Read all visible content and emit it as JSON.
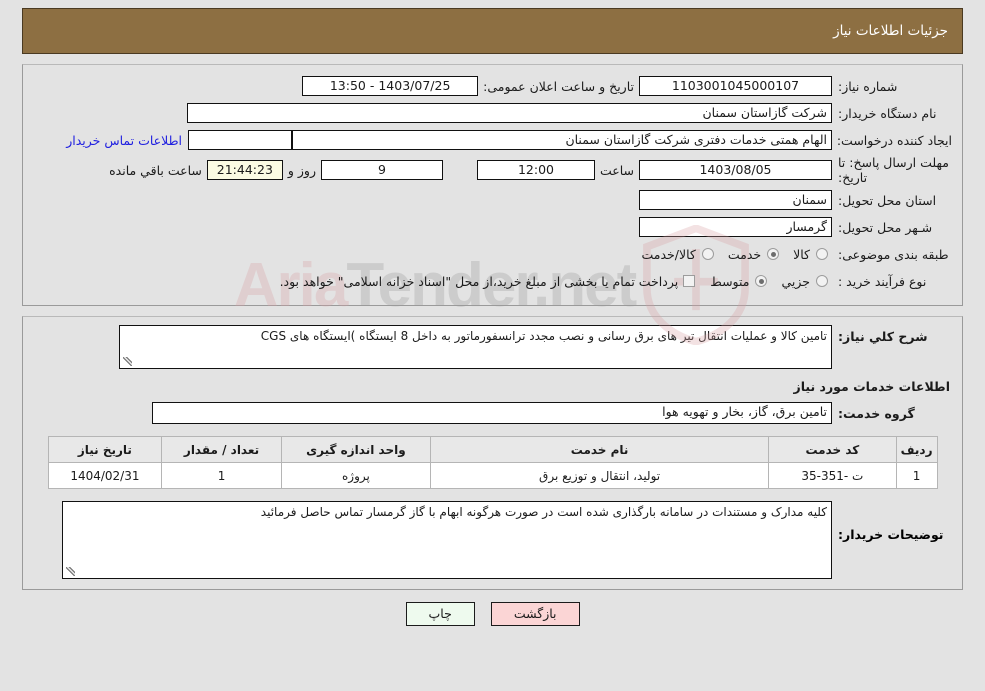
{
  "header": {
    "title": "جزئیات اطلاعات نیاز"
  },
  "form": {
    "need_number_label": "شماره نیاز:",
    "need_number_value": "1103001045000107",
    "public_announce_label": "تاریخ و ساعت اعلان عمومی:",
    "public_announce_value": "1403/07/25 - 13:50",
    "buyer_org_label": "نام دستگاه خریدار:",
    "buyer_org_value": "شرکت گازاستان سمنان",
    "creator_label": "ایجاد کننده درخواست:",
    "creator_value": "الهام همتی خدمات دفتری شرکت گازاستان سمنان",
    "contact_link": "اطلاعات تماس خریدار",
    "deadline_label_line1": "مهلت ارسال پاسخ: تا",
    "deadline_label_line2": "تاریخ:",
    "deadline_date": "1403/08/05",
    "hour_label": "ساعت",
    "deadline_time": "12:00",
    "days_value": "9",
    "days_label": "روز و",
    "countdown_value": "21:44:23",
    "countdown_label": "ساعت باقي مانده",
    "province_label": "استان محل تحویل:",
    "province_value": "سمنان",
    "city_label": "شـهر محل تحویل:",
    "city_value": "گرمسار",
    "category_label": "طبقه بندی موضوعی:",
    "category_options": [
      {
        "label": "کالا",
        "selected": false
      },
      {
        "label": "خدمت",
        "selected": true
      },
      {
        "label": "کالا/خدمت",
        "selected": false
      }
    ],
    "process_label": "نوع فرآیند خرید :",
    "process_options": [
      {
        "label": "جزیي",
        "selected": false
      },
      {
        "label": "متوسط",
        "selected": true
      }
    ],
    "treasury_checkbox_checked": false,
    "treasury_note": "پرداخت تمام یا بخشی از مبلغ خرید،از محل \"اسناد خزانه اسلامی\" خواهد بود."
  },
  "description": {
    "label": "شرح کلي نیاز:",
    "value": "تامین کالا و عملیات انتقال تیر های برق رسانی و نصب مجدد ترانسفورماتور به داخل 8 ایستگاه )ایستگاه های CGS"
  },
  "services": {
    "section_title": "اطلاعات خدمات مورد نیاز",
    "group_label": "گروه خدمت:",
    "group_value": "تامین برق، گاز، بخار و تهویه هوا",
    "table": {
      "columns": [
        "ردیف",
        "کد خدمت",
        "نام خدمت",
        "واحد اندازه گیری",
        "تعداد / مقدار",
        "تاریخ نیاز"
      ],
      "rows": [
        {
          "row": "1",
          "code": "ت -351-35",
          "name": "تولید، انتقال و توزیع برق",
          "unit": "پروژه",
          "qty": "1",
          "date": "1404/02/31"
        }
      ]
    }
  },
  "buyer_notes": {
    "label": "توضیحات خریدار:",
    "value": "کلیه مدارک و مستندات در سامانه بارگذاری شده است در صورت هرگونه ابهام با گاز گرمسار تماس حاصل فرمائید"
  },
  "footer": {
    "print_label": "چاپ",
    "back_label": "بازگشت"
  },
  "watermark": {
    "text_left": "Aria",
    "text_right": "Tender.net"
  },
  "colors": {
    "header_brown": "#8d6f42",
    "page_bg": "#e3e3e3",
    "link_blue": "#2020e0",
    "countdown_bg": "#fbfbe3",
    "print_btn_bg": "#eefaee",
    "back_btn_bg": "#fbd5d5"
  }
}
